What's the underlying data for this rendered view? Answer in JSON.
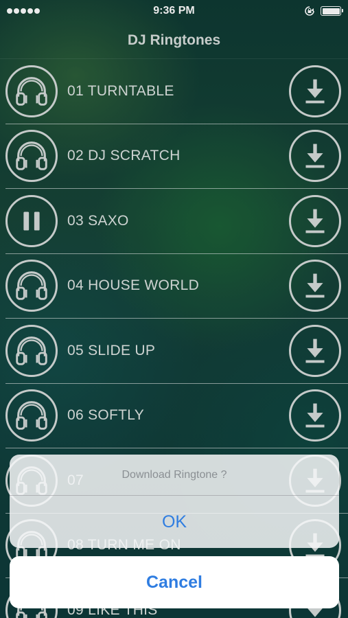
{
  "status_bar": {
    "signal_dots": 5,
    "time": "9:36 PM"
  },
  "nav": {
    "title": "DJ Ringtones"
  },
  "ringtones": [
    {
      "label": "01 TURNTABLE",
      "state": "idle",
      "icon": "headphones-icon"
    },
    {
      "label": "02 DJ SCRATCH",
      "state": "idle",
      "icon": "headphones-icon"
    },
    {
      "label": "03 SAXO",
      "state": "playing",
      "icon": "pause-icon"
    },
    {
      "label": "04 HOUSE WORLD",
      "state": "idle",
      "icon": "headphones-icon"
    },
    {
      "label": "05 SLIDE UP",
      "state": "idle",
      "icon": "headphones-icon"
    },
    {
      "label": "06 SOFTLY",
      "state": "idle",
      "icon": "headphones-icon"
    },
    {
      "label": "07",
      "state": "idle",
      "icon": "headphones-icon"
    },
    {
      "label": "08 TURN ME ON",
      "state": "idle",
      "icon": "headphones-icon"
    },
    {
      "label": "09 LIKE THIS",
      "state": "idle",
      "icon": "headphones-icon"
    }
  ],
  "action_sheet": {
    "message": "Download Ringtone ?",
    "ok_label": "OK",
    "cancel_label": "Cancel"
  },
  "colors": {
    "accent": "#2f7de1",
    "row_line": "#d6dcdb"
  }
}
